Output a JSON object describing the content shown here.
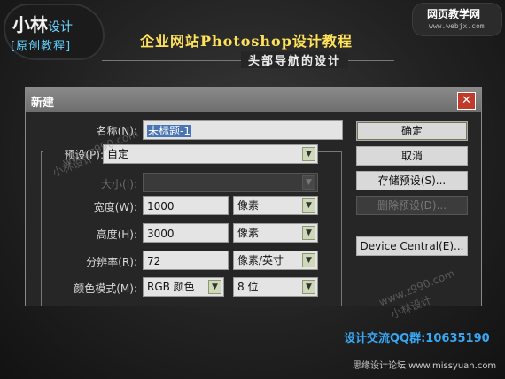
{
  "banner": {
    "logo_main": "小林",
    "logo_accent": "设计",
    "logo_sub": "[原创教程]",
    "brand_tr_name": "网页教学网",
    "brand_tr_url": "www.webjx.com",
    "title": "企业网站Photoshop设计教程",
    "subtitle": "头部导航的设计"
  },
  "dialog": {
    "title": "新建",
    "close_glyph": "✕",
    "fields": {
      "name_label": "名称(N):",
      "name_value": "未标题-1",
      "preset_label": "预设(P):",
      "preset_value": "自定",
      "size_label": "大小(I):",
      "width_label": "宽度(W):",
      "width_value": "1000",
      "width_unit": "像素",
      "height_label": "高度(H):",
      "height_value": "3000",
      "height_unit": "像素",
      "resolution_label": "分辨率(R):",
      "resolution_value": "72",
      "resolution_unit": "像素/英寸",
      "color_mode_label": "颜色模式(M):",
      "color_mode_value": "RGB 颜色",
      "bit_depth_value": "8 位"
    },
    "buttons": {
      "ok": "确定",
      "cancel": "取消",
      "save_preset": "存储预设(S)...",
      "delete_preset": "删除预设(D)...",
      "device_central": "Device Central(E)..."
    }
  },
  "watermarks": {
    "url1": "www.z990.com",
    "name1": "小林设计",
    "url2": "www.z990.com",
    "name2": "小林设计"
  },
  "qq_group": "设计交流QQ群:10635190",
  "footer": "思缘设计论坛 www.missyuan.com",
  "icons": {
    "dropdown_arrow": "chevron-down-icon"
  },
  "colors": {
    "title": "#ffe25a",
    "qq": "#38a8f5",
    "close": "#c0392b"
  }
}
